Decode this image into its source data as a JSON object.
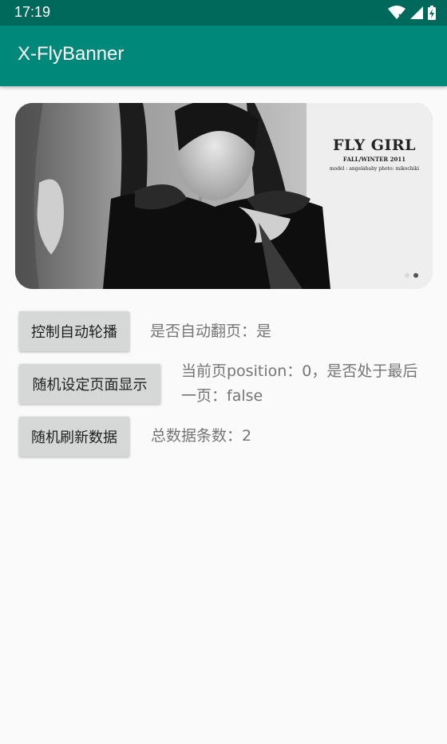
{
  "status": {
    "time": "17:19"
  },
  "app": {
    "title": "X-FlyBanner"
  },
  "banner": {
    "title": "FLY GIRL",
    "subtitle": "FALL/WINTER 2011",
    "credits": "model : angelababy    photo: mikochiki",
    "page_count": 2,
    "current_index": 1,
    "dot_colors": {
      "active": "#555555",
      "inactive": "#d9d9d9"
    }
  },
  "controls": [
    {
      "button": "控制自动轮播",
      "info": "是否自动翻页：是"
    },
    {
      "button": "随机设定页面显示",
      "info_line1": "当前页position：0，是否处于最后",
      "info_line2": "一页：false"
    },
    {
      "button": "随机刷新数据",
      "info": "总数据条数：2"
    }
  ],
  "colors": {
    "status_bar": "#00695c",
    "app_bar": "#00897b",
    "button": "#d6d7d7",
    "background": "#fafafa"
  }
}
